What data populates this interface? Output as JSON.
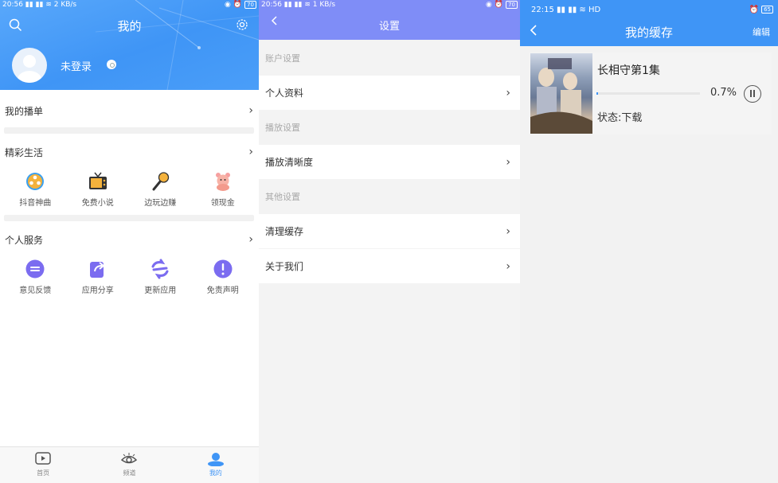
{
  "panel1": {
    "status": {
      "time": "20:56",
      "speed": "2 KB/s",
      "battery": "70"
    },
    "title": "我的",
    "user": {
      "name": "未登录"
    },
    "sections": {
      "playlist": {
        "label": "我的播单"
      },
      "life": {
        "label": "精彩生活",
        "items": [
          {
            "label": "抖音神曲",
            "icon": "film-reel-icon"
          },
          {
            "label": "免费小说",
            "icon": "tv-icon"
          },
          {
            "label": "边玩边赚",
            "icon": "microphone-icon"
          },
          {
            "label": "领现金",
            "icon": "piggy-bank-icon"
          }
        ]
      },
      "service": {
        "label": "个人服务",
        "items": [
          {
            "label": "意见反馈",
            "icon": "feedback-icon"
          },
          {
            "label": "应用分享",
            "icon": "share-icon"
          },
          {
            "label": "更新应用",
            "icon": "refresh-icon"
          },
          {
            "label": "免责声明",
            "icon": "exclamation-icon"
          }
        ]
      }
    },
    "tabs": [
      {
        "label": "首页",
        "icon": "play-icon",
        "active": false
      },
      {
        "label": "频道",
        "icon": "eye-icon",
        "active": false
      },
      {
        "label": "我的",
        "icon": "user-icon",
        "active": true
      }
    ],
    "colors": {
      "header": "#3f95f6",
      "active": "#3f95f6"
    }
  },
  "panel2": {
    "status": {
      "time": "20:56",
      "speed": "1 KB/s",
      "battery": "70"
    },
    "title": "设置",
    "groups": [
      {
        "header": "账户设置",
        "items": [
          "个人资料"
        ]
      },
      {
        "header": "播放设置",
        "items": [
          "播放清晰度"
        ]
      },
      {
        "header": "其他设置",
        "items": [
          "清理缓存",
          "关于我们"
        ]
      }
    ],
    "colors": {
      "header": "#7f8df7"
    }
  },
  "panel3": {
    "status": {
      "time": "22:15",
      "network": "HD",
      "battery": "65"
    },
    "title": "我的缓存",
    "edit": "编辑",
    "download": {
      "title": "长相守第1集",
      "progress_percent": 0.7,
      "progress_label": "0.7%",
      "status": "状态:下载"
    },
    "colors": {
      "header": "#3f95f6"
    }
  }
}
